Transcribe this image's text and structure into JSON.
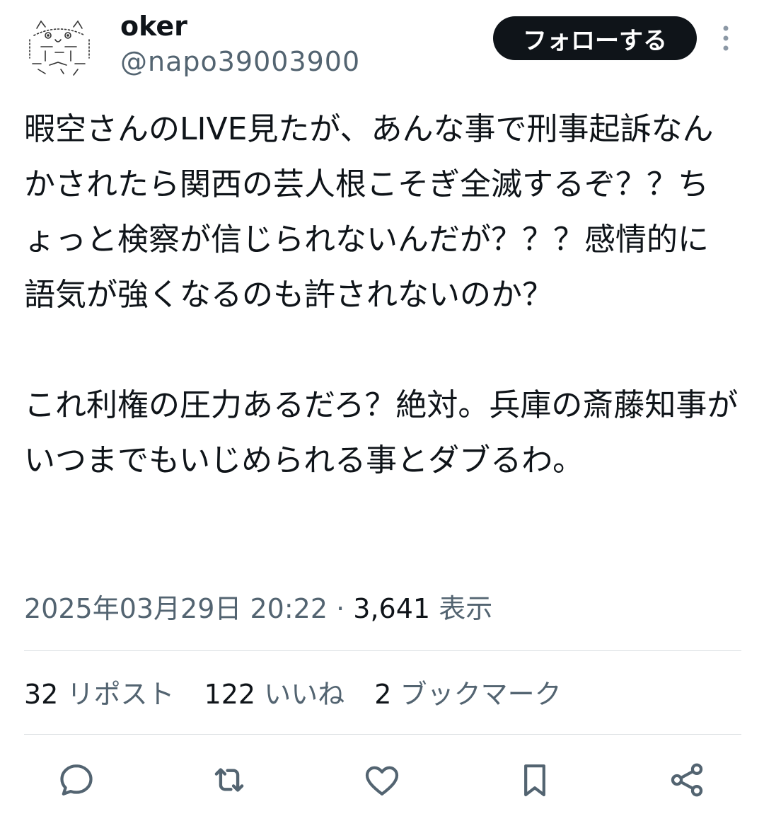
{
  "author": {
    "name": "oker",
    "handle": "@napo39003900",
    "follow_label": "フォローする"
  },
  "tweet": {
    "text": "暇空さんのLIVE見たが、あんな事で刑事起訴なんかされたら関西の芸人根こそぎ全滅するぞ？？ちょっと検察が信じられないんだが？？？感情的に語気が強くなるのも許されないのか？\n\nこれ利権の圧力あるだろ？絶対。兵庫の斎藤知事がいつまでもいじめられる事とダブるわ。",
    "timestamp": "2025年03月29日 20:22",
    "separator": "·",
    "views_count": "3,641",
    "views_label": "表示"
  },
  "stats": {
    "reposts": {
      "count": "32",
      "label": "リポスト"
    },
    "likes": {
      "count": "122",
      "label": "いいね"
    },
    "bookmarks": {
      "count": "2",
      "label": "ブックマーク"
    }
  },
  "icons": {
    "avatar": "ascii-art-cat-avatar",
    "more": "more-vertical-icon",
    "reply": "reply-icon",
    "repost": "repost-icon",
    "like": "like-icon",
    "bookmark": "bookmark-icon",
    "share": "share-icon"
  },
  "colors": {
    "text": "#0f1419",
    "secondary": "#536471",
    "button_bg": "#0f1419",
    "divider": "#d9dde1"
  }
}
